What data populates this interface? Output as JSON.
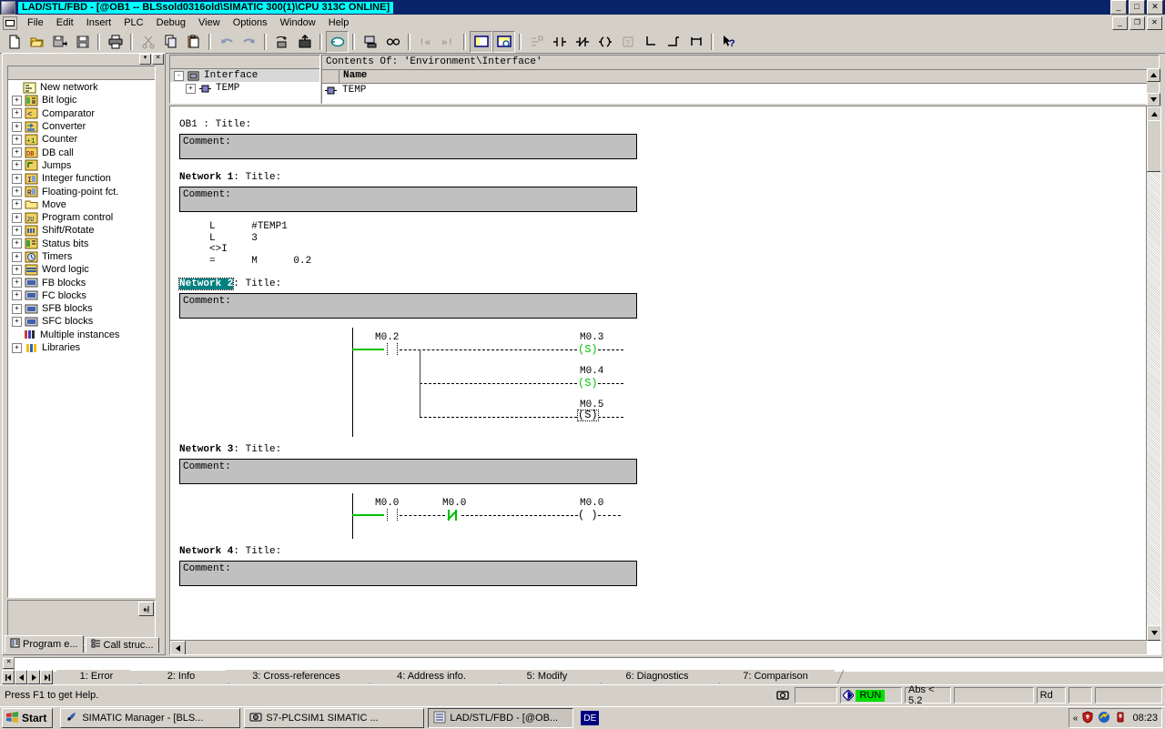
{
  "window": {
    "title": "LAD/STL/FBD  - [@OB1 -- BLSsold0316old\\SIMATIC 300(1)\\CPU 313C  ONLINE]",
    "minimize": "_",
    "maximize": "□",
    "close": "✕",
    "mdi_minimize": "_",
    "mdi_restore": "❐",
    "mdi_close": "✕"
  },
  "menu": {
    "items": [
      {
        "label": "File"
      },
      {
        "label": "Edit"
      },
      {
        "label": "Insert"
      },
      {
        "label": "PLC"
      },
      {
        "label": "Debug"
      },
      {
        "label": "View"
      },
      {
        "label": "Options"
      },
      {
        "label": "Window"
      },
      {
        "label": "Help"
      }
    ]
  },
  "toolbar": {
    "buttons": [
      {
        "name": "new-icon",
        "tip": "New"
      },
      {
        "name": "open-folder-icon",
        "tip": "Open"
      },
      {
        "name": "save-as-icon",
        "tip": "Save As"
      },
      {
        "name": "save-icon",
        "tip": "Save"
      },
      {
        "name": "print-icon",
        "tip": "Print"
      },
      {
        "name": "cut-icon",
        "tip": "Cut"
      },
      {
        "name": "copy-icon",
        "tip": "Copy"
      },
      {
        "name": "paste-icon",
        "tip": "Paste"
      },
      {
        "name": "undo-icon",
        "tip": "Undo"
      },
      {
        "name": "redo-icon",
        "tip": "Redo"
      },
      {
        "name": "download-icon",
        "tip": "Download"
      },
      {
        "name": "upload-icon",
        "tip": "Upload"
      },
      {
        "name": "monitor-icon",
        "tip": "Monitor"
      },
      {
        "name": "monitor-modify-icon",
        "tip": "Monitor/Modify Variables"
      },
      {
        "name": "glasses-icon",
        "tip": "Display Symbolic"
      },
      {
        "name": "prev-error-icon",
        "tip": "Previous Error"
      },
      {
        "name": "next-error-icon",
        "tip": "Next Error"
      },
      {
        "name": "overviews-icon",
        "tip": "Overviews"
      },
      {
        "name": "details-icon",
        "tip": "Details"
      },
      {
        "name": "network-icon",
        "tip": "New Network"
      },
      {
        "name": "no-contact-icon",
        "tip": "Normally Open Contact"
      },
      {
        "name": "nc-contact-icon",
        "tip": "Normally Closed Contact"
      },
      {
        "name": "coil-icon",
        "tip": "Output Coil"
      },
      {
        "name": "empty-box-icon",
        "tip": "Empty Box"
      },
      {
        "name": "branch-open-icon",
        "tip": "Open Branch"
      },
      {
        "name": "branch-close-icon",
        "tip": "Close Branch"
      },
      {
        "name": "parallel-icon",
        "tip": "Parallel Branch"
      },
      {
        "name": "help-pointer-icon",
        "tip": "Context Help"
      }
    ]
  },
  "left_panel": {
    "collapse_label": "▾",
    "close_label": "✕",
    "tree": [
      {
        "label": "New network",
        "icon": "new-network-icon",
        "expandable": false
      },
      {
        "label": "Bit logic",
        "icon": "bit-logic-icon",
        "expandable": true
      },
      {
        "label": "Comparator",
        "icon": "comparator-icon",
        "expandable": true
      },
      {
        "label": "Converter",
        "icon": "converter-icon",
        "expandable": true
      },
      {
        "label": "Counter",
        "icon": "counter-icon",
        "expandable": true
      },
      {
        "label": "DB call",
        "icon": "db-call-icon",
        "expandable": true
      },
      {
        "label": "Jumps",
        "icon": "jumps-icon",
        "expandable": true
      },
      {
        "label": "Integer function",
        "icon": "integer-function-icon",
        "expandable": true
      },
      {
        "label": "Floating-point fct.",
        "icon": "float-function-icon",
        "expandable": true
      },
      {
        "label": "Move",
        "icon": "move-icon",
        "expandable": true
      },
      {
        "label": "Program control",
        "icon": "program-control-icon",
        "expandable": true
      },
      {
        "label": "Shift/Rotate",
        "icon": "shift-rotate-icon",
        "expandable": true
      },
      {
        "label": "Status bits",
        "icon": "status-bits-icon",
        "expandable": true
      },
      {
        "label": "Timers",
        "icon": "timers-icon",
        "expandable": true
      },
      {
        "label": "Word logic",
        "icon": "word-logic-icon",
        "expandable": true
      },
      {
        "label": "FB blocks",
        "icon": "fb-blocks-icon",
        "expandable": true
      },
      {
        "label": "FC blocks",
        "icon": "fc-blocks-icon",
        "expandable": true
      },
      {
        "label": "SFB blocks",
        "icon": "sfb-blocks-icon",
        "expandable": true
      },
      {
        "label": "SFC blocks",
        "icon": "sfc-blocks-icon",
        "expandable": true
      },
      {
        "label": "Multiple instances",
        "icon": "multiple-instances-icon",
        "expandable": false
      },
      {
        "label": "Libraries",
        "icon": "libraries-icon",
        "expandable": true
      }
    ],
    "tabs": [
      {
        "label": "Program e...",
        "active": true,
        "icon": "program-elements-icon"
      },
      {
        "label": "Call struc...",
        "active": false,
        "icon": "call-structure-icon"
      }
    ]
  },
  "interface": {
    "tree": [
      {
        "label": "Interface",
        "depth": 0,
        "expander": "-",
        "icon": "interface-icon"
      },
      {
        "label": "TEMP",
        "depth": 1,
        "expander": "+",
        "icon": "temp-icon"
      }
    ],
    "contents_of": "Contents Of:  'Environment\\Interface'",
    "column_header": "Name",
    "rows": [
      {
        "name": "TEMP",
        "icon": "temp-icon"
      }
    ],
    "scroll_up": "▲",
    "scroll_down": "▼"
  },
  "editor": {
    "block_title": "OB1 : Title:",
    "networks": [
      {
        "id": "ob1-header",
        "kind": "header",
        "comment": "Comment:"
      },
      {
        "id": "network-1",
        "kind": "stl",
        "label_bold": "Network 1",
        "label_rest": ": Title:",
        "highlighted": false,
        "comment": "Comment:",
        "stl_lines": [
          "     L      #TEMP1",
          "     L      3",
          "     <>I",
          "     =      M      0.2"
        ]
      },
      {
        "id": "network-2",
        "kind": "ladder",
        "label_bold": "Network 2",
        "label_rest": ": Title:",
        "highlighted": true,
        "comment": "Comment:",
        "contacts": [
          {
            "address": "M0.2",
            "type": "no-contact",
            "state": "off"
          }
        ],
        "coils": [
          {
            "address": "M0.3",
            "type": "set-coil",
            "glyph": "(S)",
            "selected": false
          },
          {
            "address": "M0.4",
            "type": "set-coil",
            "glyph": "(S)",
            "selected": false
          },
          {
            "address": "M0.5",
            "type": "set-coil",
            "glyph": "(S)",
            "selected": true
          }
        ]
      },
      {
        "id": "network-3",
        "kind": "ladder",
        "label_bold": "Network 3",
        "label_rest": ": Title:",
        "highlighted": false,
        "comment": "Comment:",
        "contacts": [
          {
            "address": "M0.0",
            "type": "no-contact",
            "state": "off"
          },
          {
            "address": "M0.0",
            "type": "nc-contact",
            "state": "on"
          }
        ],
        "coils": [
          {
            "address": "M0.0",
            "type": "output-coil",
            "glyph": "( )",
            "selected": false
          }
        ]
      },
      {
        "id": "network-4",
        "kind": "empty",
        "label_bold": "Network 4",
        "label_rest": ": Title:",
        "highlighted": false,
        "comment": "Comment:"
      }
    ],
    "scroll": {
      "up": "▲",
      "down": "▼",
      "left": "◄",
      "right": "►"
    }
  },
  "output": {
    "close_label": "✕",
    "nav": [
      "◀◀",
      "◀",
      "▶",
      "▶▶"
    ],
    "tabs": [
      {
        "label": "1: Error",
        "active": false
      },
      {
        "label": "2: Info",
        "active": true
      },
      {
        "label": "3: Cross-references",
        "active": false
      },
      {
        "label": "4: Address info.",
        "active": false
      },
      {
        "label": "5: Modify",
        "active": false
      },
      {
        "label": "6: Diagnostics",
        "active": false
      },
      {
        "label": "7: Comparison",
        "active": false
      }
    ]
  },
  "statusbar": {
    "message": "Press F1 to get Help.",
    "cells": [
      {
        "name": "offline-online-icon",
        "text": ""
      },
      {
        "name": "blank-cell-1",
        "text": ""
      },
      {
        "name": "plc-mode",
        "text": "RUN",
        "highlight": "#00e000"
      },
      {
        "name": "abs-cell",
        "text": "Abs < 5.2"
      },
      {
        "name": "blank-cell-2",
        "text": ""
      },
      {
        "name": "rd-cell",
        "text": "Rd"
      },
      {
        "name": "blank-cell-3",
        "text": ""
      },
      {
        "name": "blank-cell-4",
        "text": ""
      }
    ]
  },
  "taskbar": {
    "start_label": "Start",
    "buttons": [
      {
        "label": "SIMATIC Manager - [BLS...",
        "icon": "simatic-manager-icon",
        "active": false
      },
      {
        "label": "S7-PLCSIM1    SIMATIC ...",
        "icon": "plcsim-icon",
        "active": false
      },
      {
        "label": "LAD/STL/FBD  - [@OB...",
        "icon": "lad-stl-fbd-icon",
        "active": true
      }
    ],
    "language": "DE",
    "tray_chevron": "«",
    "tray_icons": [
      "shield-icon",
      "network-activity-icon",
      "usb-device-icon"
    ],
    "time": "08:23"
  },
  "colors": {
    "titlebar_bg": "#0a246a",
    "title_highlight": "#00ffff",
    "window_face": "#d4d0c8",
    "comment_box": "#c0c0c0",
    "ladder_green": "#00c000",
    "network_selection": "#008080",
    "run_green": "#00e000"
  }
}
